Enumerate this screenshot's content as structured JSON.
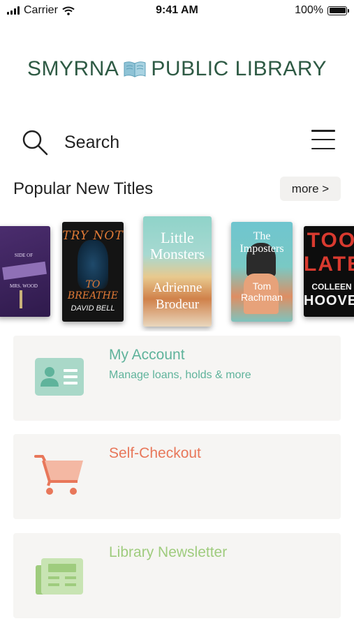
{
  "status_bar": {
    "carrier": "Carrier",
    "time": "9:41 AM",
    "battery": "100%"
  },
  "header": {
    "logo_left": "SMYRNA",
    "logo_right": "PUBLIC LIBRARY"
  },
  "search": {
    "label": "Search"
  },
  "popular": {
    "title": "Popular New Titles",
    "more_label": "more >",
    "books": [
      {
        "line1": "SIDE OF",
        "line2": "MRS. WOOD"
      },
      {
        "line1": "TRY NOT",
        "line2": "TO BREATHE",
        "author": "DAVID BELL"
      },
      {
        "line1": "Little",
        "line2": "Monsters",
        "author1": "Adrienne",
        "author2": "Brodeur"
      },
      {
        "line1": "The",
        "line2": "Imposters",
        "author1": "Tom",
        "author2": "Rachman"
      },
      {
        "line1": "TOO",
        "line2": "LATE",
        "author1": "COLLEEN",
        "author2": "HOOVER"
      }
    ]
  },
  "cards": [
    {
      "title": "My Account",
      "subtitle": "Manage loans, holds & more",
      "color": "#5fb39b",
      "icon": "account-card-icon"
    },
    {
      "title": "Self-Checkout",
      "color": "#e8775a",
      "icon": "shopping-cart-icon"
    },
    {
      "title": "Library Newsletter",
      "color": "#9fcc7e",
      "icon": "newspaper-icon"
    }
  ],
  "colors": {
    "brand": "#2e5a44",
    "card_bg": "#f6f5f3"
  }
}
